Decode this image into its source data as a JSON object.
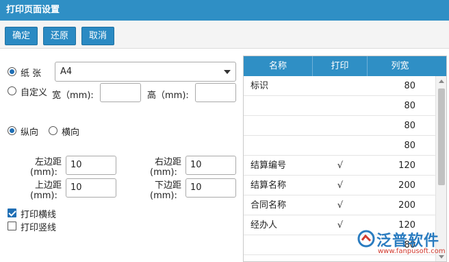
{
  "window": {
    "title": "打印页面设置"
  },
  "toolbar": {
    "ok": "确定",
    "reset": "还原",
    "cancel": "取消"
  },
  "paper": {
    "paper_label": "纸 张",
    "paper_value": "A4",
    "custom_label": "自定义",
    "width_label": "宽（mm):",
    "height_label": "高（mm):",
    "width_value": "",
    "height_value": "",
    "selected": "paper"
  },
  "orientation": {
    "portrait": "纵向",
    "landscape": "横向",
    "selected": "portrait"
  },
  "margins": {
    "left_label_1": "左边距",
    "left_label_2": "(mm):",
    "left_value": "10",
    "right_label_1": "右边距",
    "right_label_2": "(mm):",
    "right_value": "10",
    "top_label_1": "上边距",
    "top_label_2": "(mm):",
    "top_value": "10",
    "bottom_label_1": "下边距",
    "bottom_label_2": "(mm):",
    "bottom_value": "10"
  },
  "lines": {
    "horizontal": "打印横线",
    "horizontal_checked": true,
    "vertical": "打印竖线",
    "vertical_checked": false
  },
  "grid": {
    "headers": [
      "名称",
      "打印",
      "列宽"
    ],
    "rows": [
      {
        "name": "标识",
        "print": "",
        "width": "80"
      },
      {
        "name": "",
        "print": "",
        "width": "80"
      },
      {
        "name": "",
        "print": "",
        "width": "80"
      },
      {
        "name": "",
        "print": "",
        "width": "80"
      },
      {
        "name": "结算编号",
        "print": "√",
        "width": "120"
      },
      {
        "name": "结算名称",
        "print": "√",
        "width": "200"
      },
      {
        "name": "合同名称",
        "print": "√",
        "width": "200"
      },
      {
        "name": "经办人",
        "print": "√",
        "width": "120"
      },
      {
        "name": "",
        "print": "",
        "width": "80"
      }
    ]
  },
  "watermark": {
    "brand": "泛普软件",
    "url": "www.fanpusoft.com"
  },
  "colors": {
    "header": "#2f8fc5",
    "button": "#2a8ac3",
    "accent": "#1f6fb5"
  }
}
